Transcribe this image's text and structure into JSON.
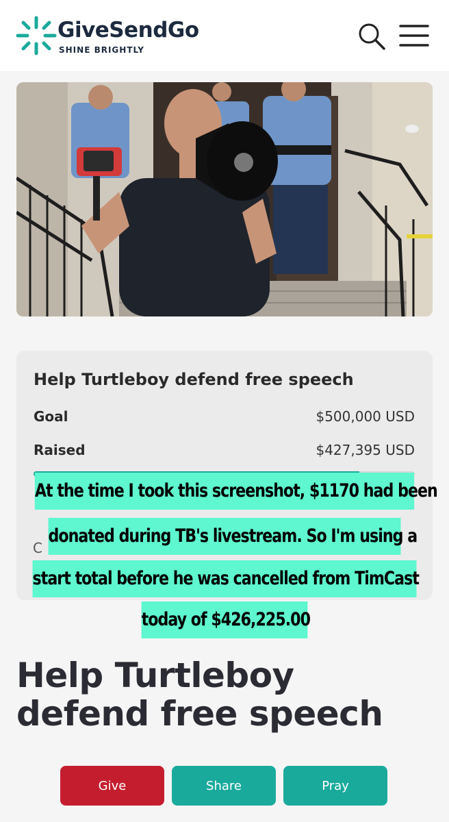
{
  "header": {
    "brand_name": "GiveSendGo",
    "tagline": "SHINE BRIGHTLY",
    "search_icon": "search-icon",
    "menu_icon": "hamburger-menu-icon",
    "brand_color": "#1aa99a"
  },
  "campaign": {
    "card_title": "Help Turtleboy defend free speech",
    "goal_label": "Goal",
    "goal_value": "$500,000 USD",
    "raised_label": "Raised",
    "raised_value": "$427,395 USD",
    "progress_fraction": 0.855,
    "obscured_text": "C"
  },
  "overlay_caption": {
    "lines": [
      "At the time I took this screenshot, $1170 had been",
      "donated during TB's livestream. So I'm using a",
      "start total before he was cancelled from TimCast",
      "today of $426,225.00"
    ],
    "highlight_color": "#5ef7cf"
  },
  "page_title": "Help Turtleboy defend free speech",
  "actions": {
    "give_label": "Give",
    "share_label": "Share",
    "pray_label": "Pray",
    "give_color": "#c41e2e",
    "share_color": "#1aaa9c"
  }
}
